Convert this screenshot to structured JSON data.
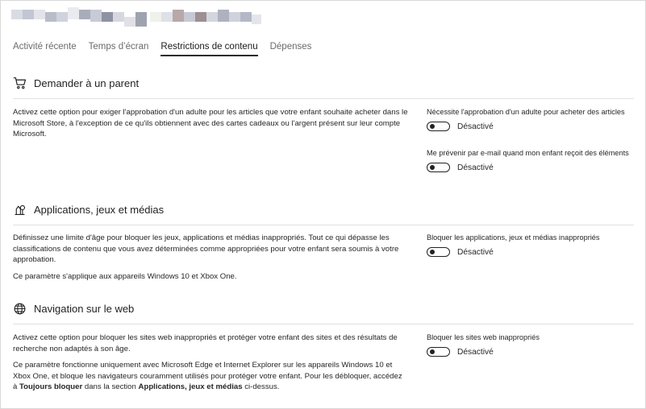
{
  "tabs": [
    {
      "label": "Activité récente"
    },
    {
      "label": "Temps d’écran"
    },
    {
      "label": "Restrictions de contenu"
    },
    {
      "label": "Dépenses"
    }
  ],
  "active_tab": "Restrictions de contenu",
  "colors": {
    "text": "#1f1f1f",
    "muted": "#6b6b6b",
    "divider": "#e1e1e1"
  },
  "sections": {
    "ask_parent": {
      "icon": "cart-icon",
      "title": "Demander à un parent",
      "description": "Activez cette option pour exiger l'approbation d'un adulte pour les articles que votre enfant souhaite acheter dans le Microsoft Store, à l'exception de ce qu'ils obtiennent avec des cartes cadeaux ou l'argent présent sur leur compte Microsoft.",
      "settings": [
        {
          "label": "Nécessite l'approbation d'un adulte pour acheter des articles",
          "state": "Désactivé"
        },
        {
          "label": "Me prévenir par e-mail quand mon enfant reçoit des éléments",
          "state": "Désactivé"
        }
      ]
    },
    "apps": {
      "icon": "apps-games-media-icon",
      "title": "Applications, jeux et médias",
      "description": "Définissez une limite d'âge pour bloquer les jeux, applications et médias inappropriés. Tout ce qui dépasse les classifications de contenu que vous avez déterminées comme appropriées pour votre enfant sera soumis à votre approbation.",
      "note": "Ce paramètre s'applique aux appareils Windows 10 et Xbox One.",
      "settings": [
        {
          "label": "Bloquer les applications, jeux et médias inappropriés",
          "state": "Désactivé"
        }
      ]
    },
    "web": {
      "icon": "globe-icon",
      "title": "Navigation sur le web",
      "description": "Activez cette option pour bloquer les sites web inappropriés et protéger votre enfant des sites et des résultats de recherche non adaptés à son âge.",
      "note_prefix": "Ce paramètre fonctionne uniquement avec Microsoft Edge et Internet Explorer sur les appareils Windows 10 et Xbox One, et bloque les navigateurs couramment utilisés pour protéger votre enfant. Pour les débloquer, accédez à ",
      "note_bold1": "Toujours bloquer",
      "note_mid": " dans la section ",
      "note_bold2": "Applications, jeux et médias",
      "note_suffix": " ci-dessus.",
      "settings": [
        {
          "label": "Bloquer les sites web inappropriés",
          "state": "Désactivé"
        }
      ]
    }
  }
}
